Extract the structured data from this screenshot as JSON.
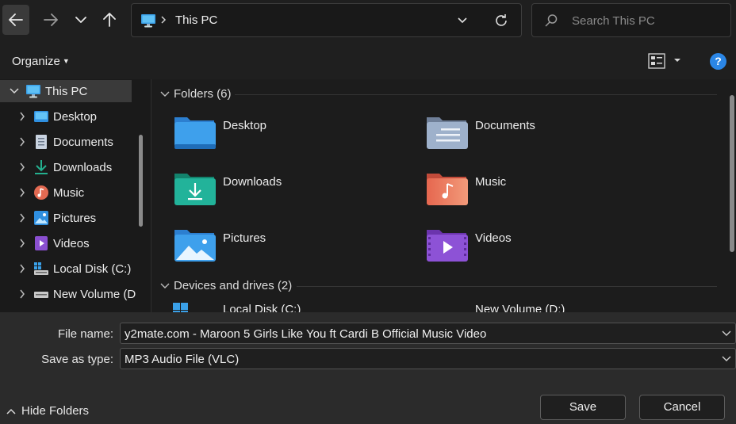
{
  "nav": {
    "back_icon": "arrow-left-icon",
    "forward_icon": "arrow-right-icon",
    "recent_icon": "chevron-down-icon",
    "up_icon": "arrow-up-icon"
  },
  "address": {
    "location_icon": "this-pc-icon",
    "breadcrumb": "This PC"
  },
  "search": {
    "placeholder": "Search This PC"
  },
  "command_bar": {
    "organize_label": "Organize",
    "view_icon": "view-options-icon",
    "help_label": "?"
  },
  "sidebar": {
    "items": [
      {
        "label": "This PC",
        "icon": "this-pc-icon",
        "expanded": true,
        "selected": true
      },
      {
        "label": "Desktop",
        "icon": "desktop-icon"
      },
      {
        "label": "Documents",
        "icon": "documents-icon"
      },
      {
        "label": "Downloads",
        "icon": "downloads-icon"
      },
      {
        "label": "Music",
        "icon": "music-icon"
      },
      {
        "label": "Pictures",
        "icon": "pictures-icon"
      },
      {
        "label": "Videos",
        "icon": "videos-icon"
      },
      {
        "label": "Local Disk (C:)",
        "icon": "local-disk-icon"
      },
      {
        "label": "New Volume (D",
        "icon": "drive-icon"
      }
    ]
  },
  "content": {
    "folders_header": "Folders (6)",
    "folders": [
      {
        "label": "Desktop",
        "icon": "desktop-folder-icon",
        "color": "#2f8fe0"
      },
      {
        "label": "Documents",
        "icon": "documents-folder-icon",
        "color": "#8fa3c0"
      },
      {
        "label": "Downloads",
        "icon": "downloads-folder-icon",
        "color": "#1fa58a"
      },
      {
        "label": "Music",
        "icon": "music-folder-icon",
        "color": "#e06a4e"
      },
      {
        "label": "Pictures",
        "icon": "pictures-folder-icon",
        "color": "#2f8fe0"
      },
      {
        "label": "Videos",
        "icon": "videos-folder-icon",
        "color": "#8a4fd0"
      }
    ],
    "drives_header": "Devices and drives (2)",
    "drives": [
      {
        "label": "Local Disk (C:)",
        "icon": "windows-drive-icon"
      },
      {
        "label": "New Volume (D:)",
        "icon": "drive-icon"
      }
    ]
  },
  "form": {
    "file_name_label": "File name:",
    "file_name_value": "y2mate.com - Maroon 5  Girls Like You ft Cardi B Official Music Video",
    "save_type_label": "Save as type:",
    "save_type_value": "MP3 Audio File (VLC)",
    "hide_folders_label": "Hide Folders",
    "save_label": "Save",
    "cancel_label": "Cancel"
  },
  "colors": {
    "accent": "#2b86e6",
    "background": "#1c1c1c",
    "footer": "#2b2b2b"
  }
}
